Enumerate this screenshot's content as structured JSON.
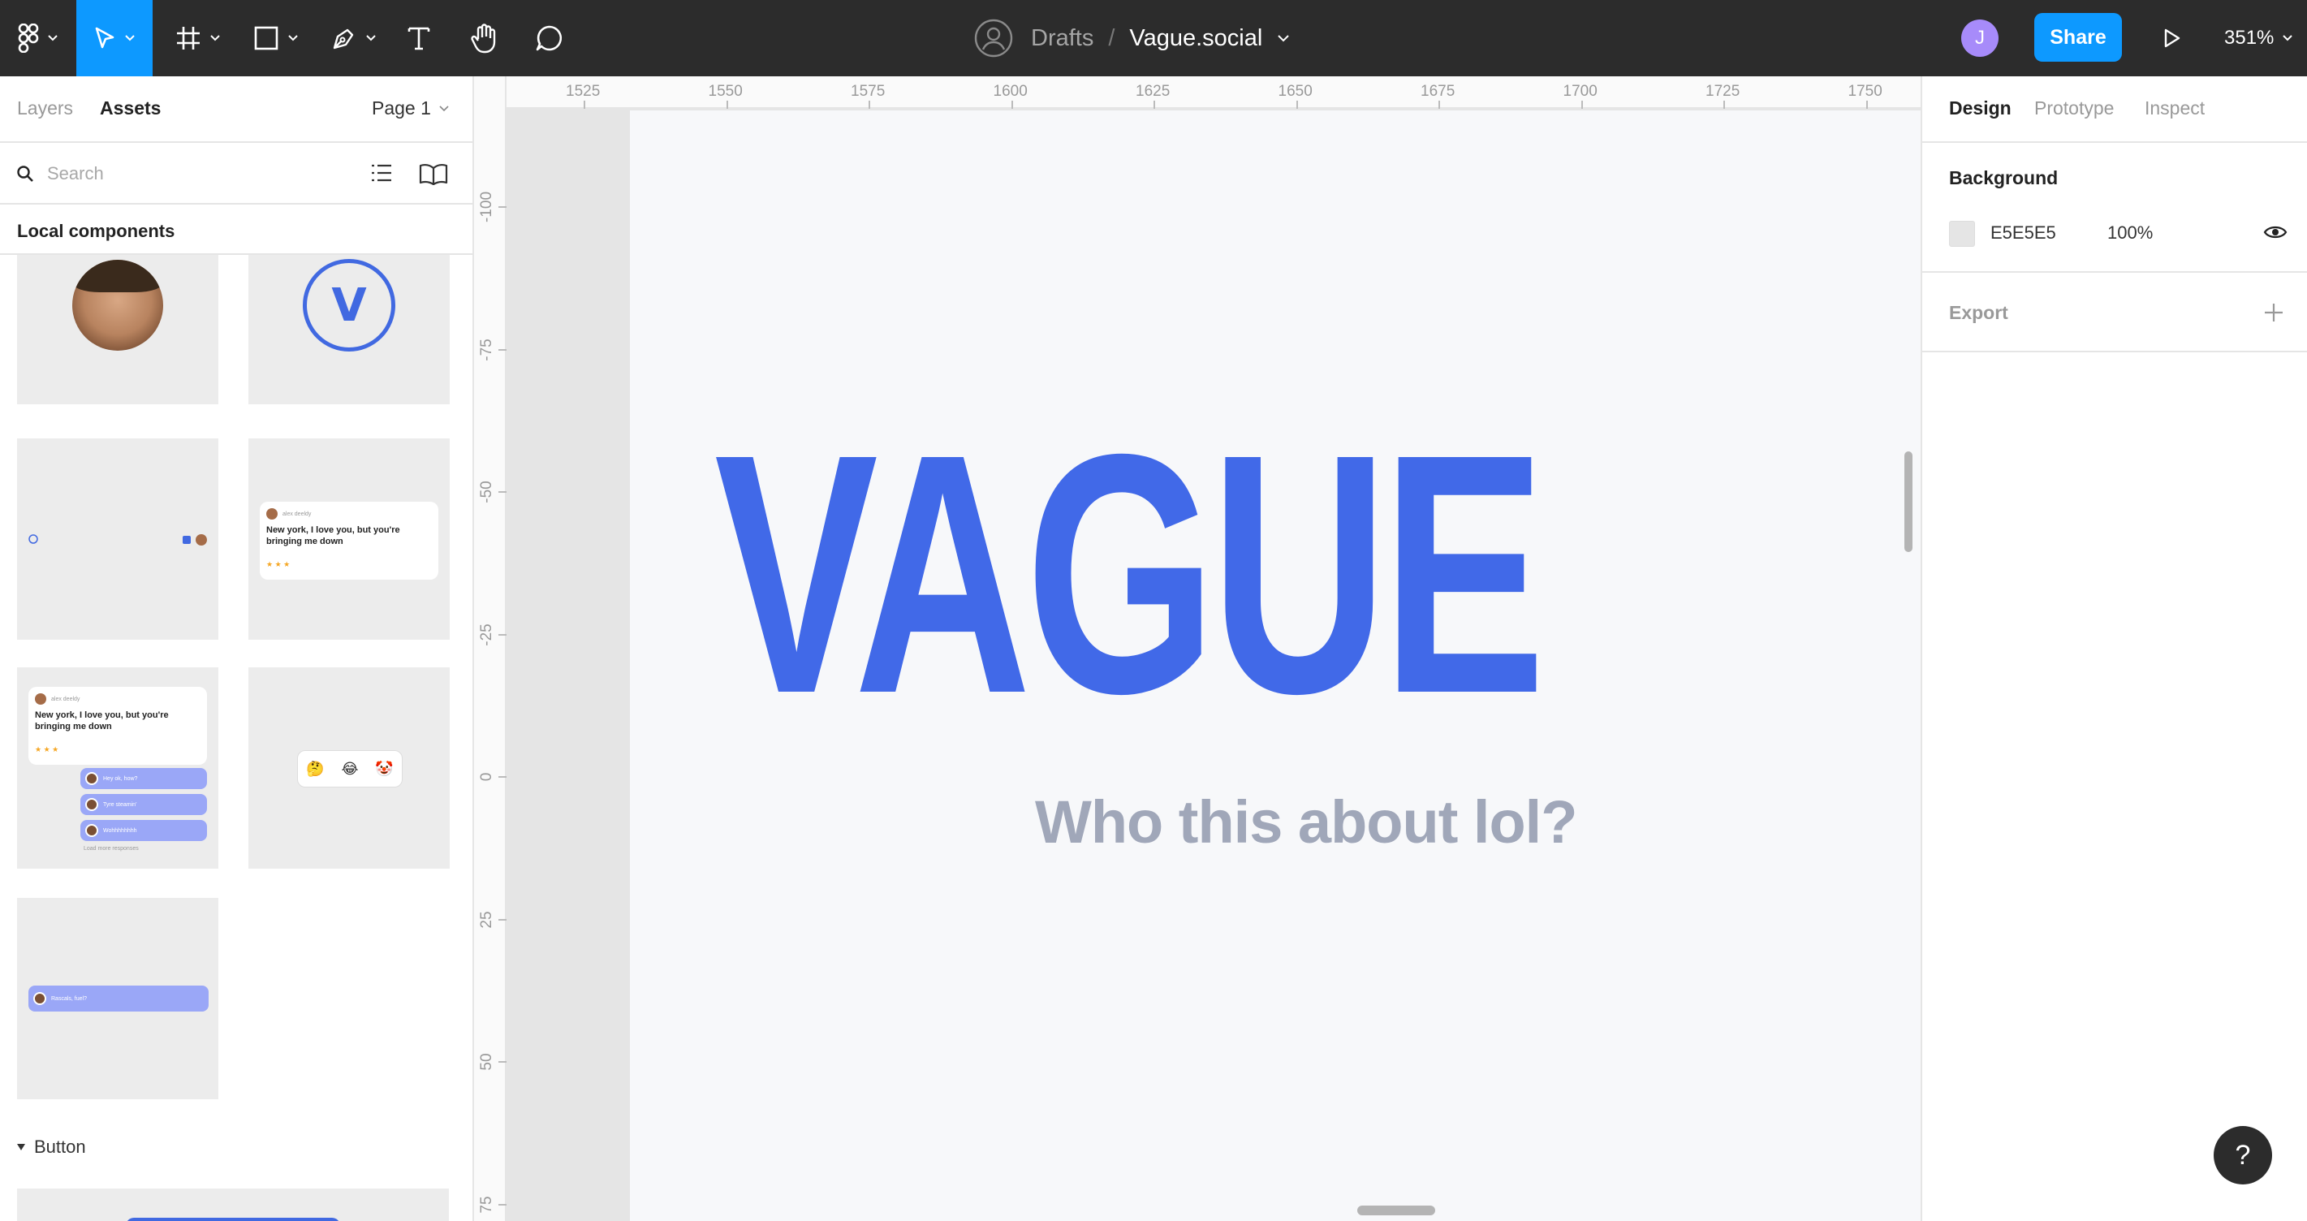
{
  "toolbar": {
    "breadcrumb_drafts": "Drafts",
    "breadcrumb_sep": "/",
    "file_name": "Vague.social",
    "avatar_initial": "J",
    "share_label": "Share",
    "zoom_level": "351%"
  },
  "left_panel": {
    "tabs": {
      "layers": "Layers",
      "assets": "Assets",
      "page": "Page 1"
    },
    "search_placeholder": "Search",
    "local_components_label": "Local components",
    "thumb_texts": {
      "post_name": "alex deeldy",
      "post_text": "New york, I love you, but you're bringing me down",
      "stars": "★ ★ ★",
      "pill_1": "Hey ok, how?",
      "pill_2": "Tyre steamin'",
      "pill_3": "Wohhhhhhhh",
      "load_more": "Load more responses",
      "reply_pill": "Rascals, fuel?"
    },
    "emojis": [
      "🤔",
      "😂",
      "🤡"
    ],
    "button_section_label": "Button"
  },
  "canvas": {
    "ruler_top": [
      "1525",
      "1550",
      "1575",
      "1600",
      "1625",
      "1650",
      "1675",
      "1700",
      "1725",
      "1750"
    ],
    "ruler_left": [
      "-100",
      "-75",
      "-50",
      "-25",
      "0",
      "25",
      "50",
      "75"
    ],
    "logo_text": "VAGUE",
    "tagline": "Who this about lol?"
  },
  "right_panel": {
    "tabs": {
      "design": "Design",
      "prototype": "Prototype",
      "inspect": "Inspect"
    },
    "background_label": "Background",
    "background_hex": "E5E5E5",
    "background_opacity": "100%",
    "export_label": "Export"
  },
  "help_label": "?",
  "colors": {
    "toolbar_bg": "#2c2c2c",
    "accent": "#0d99ff",
    "brand_blue": "#4169e8",
    "tagline_gray": "#a0a7b9",
    "canvas_bg": "#e5e5e5",
    "frame_bg": "#f7f8fa"
  }
}
